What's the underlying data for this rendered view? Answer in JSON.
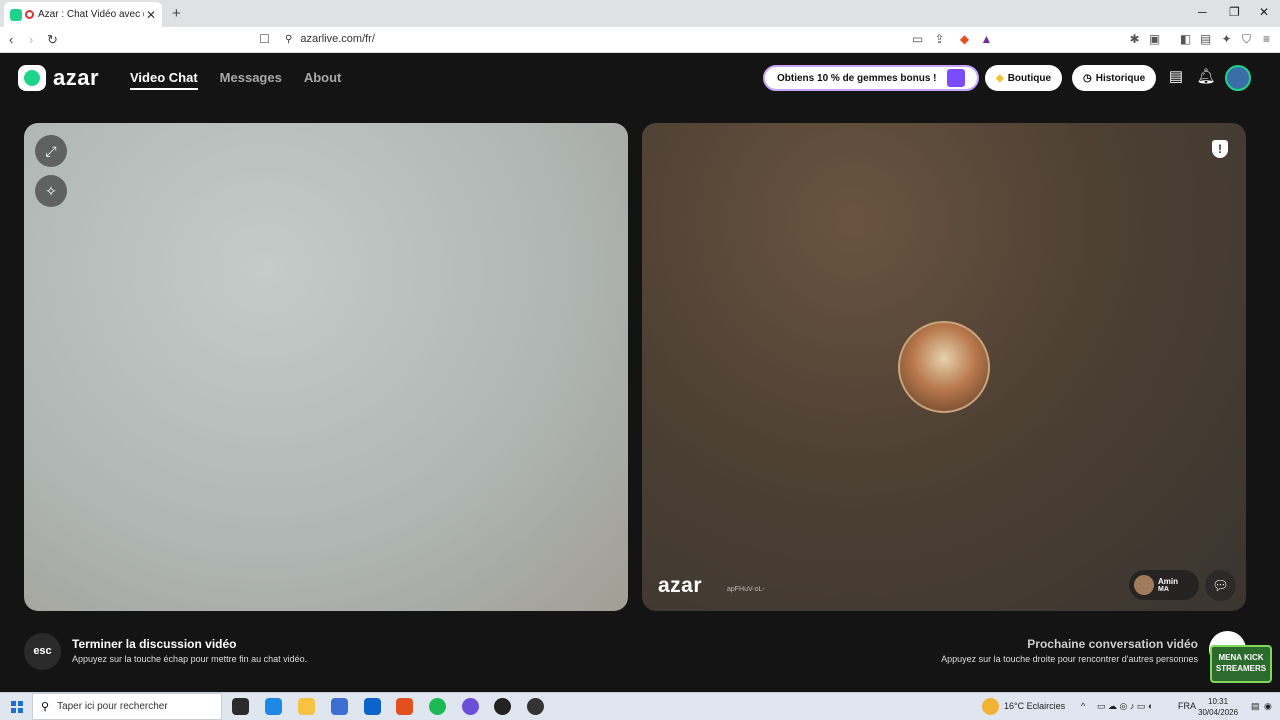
{
  "browser": {
    "tab_title": "Azar : Chat Vidéo avec de no",
    "tab_close": "✕",
    "new_tab": "+",
    "url": "azarlive.com/fr/",
    "win_min": "─",
    "win_max": "❐",
    "win_close": "✕"
  },
  "header": {
    "logo_text": "azar",
    "nav": [
      {
        "label": "Video Chat",
        "active": true
      },
      {
        "label": "Messages",
        "active": false
      },
      {
        "label": "About",
        "active": false
      }
    ],
    "promo_text": "Obtiens 10 % de gemmes bonus !",
    "shop_label": "Boutique",
    "history_label": "Historique"
  },
  "remote": {
    "watermark": "azar",
    "peer_id": "apFHuV-oL-",
    "user_name": "Amin",
    "country": "MA"
  },
  "footer": {
    "esc_key": "esc",
    "end_title": "Terminer la discussion vidéo",
    "end_sub": "Appuyez sur la touche échap pour mettre fin au chat vidéo.",
    "next_title": "Prochaine conversation vidéo",
    "next_sub": "Appuyez sur la touche droite pour rencontrer d'autres personnes",
    "overlay_badge": "MENA KICK STREAMERS"
  },
  "taskbar": {
    "search_placeholder": "Taper ici pour rechercher",
    "weather": "16°C  Eclaircies",
    "lang": "FRA",
    "time": "10:31",
    "date": "30/04/2026"
  },
  "colors": {
    "accent": "#1fd38a",
    "background": "#141414"
  }
}
